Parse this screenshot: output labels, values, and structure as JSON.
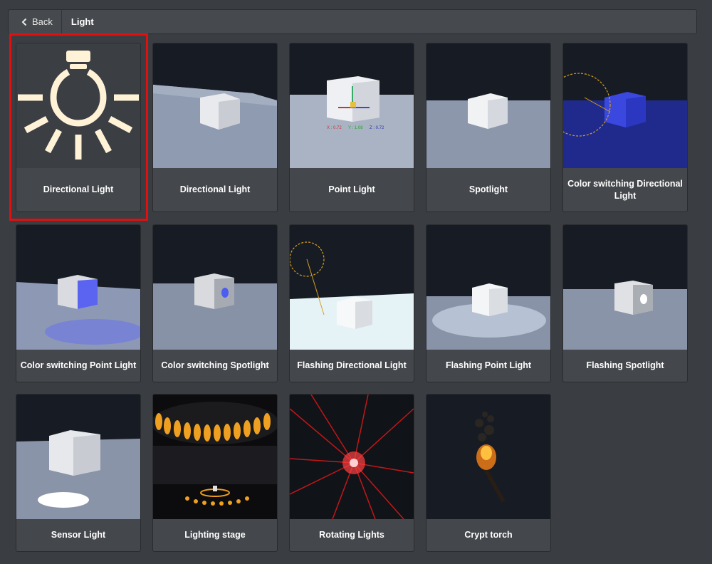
{
  "topbar": {
    "back_label": "Back",
    "breadcrumb_current": "Light"
  },
  "colors": {
    "background": "#3a3d41",
    "card": "#44474b",
    "selection": "#e01010",
    "bulb": "#fff2d6"
  },
  "selected_card": "Directional Light",
  "cards": [
    {
      "label": "Directional Light",
      "thumbnail": "lightbulb-icon"
    },
    {
      "label": "Directional Light",
      "thumbnail": "cube-scene"
    },
    {
      "label": "Point Light",
      "thumbnail": "cube-gizmo-scene"
    },
    {
      "label": "Spotlight",
      "thumbnail": "cube-scene"
    },
    {
      "label": "Color switching Directional Light",
      "thumbnail": "blue-cube-scene"
    },
    {
      "label": "Color switching Point Light",
      "thumbnail": "cube-blue-light-scene"
    },
    {
      "label": "Color switching Spotlight",
      "thumbnail": "cube-spot-scene"
    },
    {
      "label": "Flashing Directional Light",
      "thumbnail": "bright-floor-scene"
    },
    {
      "label": "Flashing Point Light",
      "thumbnail": "cube-glow-scene"
    },
    {
      "label": "Flashing Spotlight",
      "thumbnail": "cube-spot-white-scene"
    },
    {
      "label": "Sensor Light",
      "thumbnail": "sensor-scene"
    },
    {
      "label": "Lighting stage",
      "thumbnail": "stage-scene"
    },
    {
      "label": "Rotating Lights",
      "thumbnail": "red-rays-scene"
    },
    {
      "label": "Crypt torch",
      "thumbnail": "torch-scene"
    }
  ],
  "gizmo": {
    "x": "X : 0.72",
    "y": "Y : 1.08",
    "z": "Z : 0.72"
  }
}
